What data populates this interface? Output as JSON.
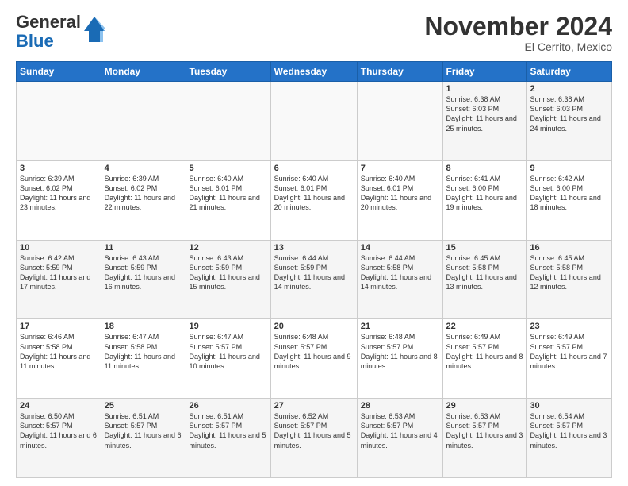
{
  "logo": {
    "general": "General",
    "blue": "Blue"
  },
  "title": "November 2024",
  "location": "El Cerrito, Mexico",
  "days_header": [
    "Sunday",
    "Monday",
    "Tuesday",
    "Wednesday",
    "Thursday",
    "Friday",
    "Saturday"
  ],
  "weeks": [
    [
      {
        "day": "",
        "content": ""
      },
      {
        "day": "",
        "content": ""
      },
      {
        "day": "",
        "content": ""
      },
      {
        "day": "",
        "content": ""
      },
      {
        "day": "",
        "content": ""
      },
      {
        "day": "1",
        "content": "Sunrise: 6:38 AM\nSunset: 6:03 PM\nDaylight: 11 hours and 25 minutes."
      },
      {
        "day": "2",
        "content": "Sunrise: 6:38 AM\nSunset: 6:03 PM\nDaylight: 11 hours and 24 minutes."
      }
    ],
    [
      {
        "day": "3",
        "content": "Sunrise: 6:39 AM\nSunset: 6:02 PM\nDaylight: 11 hours and 23 minutes."
      },
      {
        "day": "4",
        "content": "Sunrise: 6:39 AM\nSunset: 6:02 PM\nDaylight: 11 hours and 22 minutes."
      },
      {
        "day": "5",
        "content": "Sunrise: 6:40 AM\nSunset: 6:01 PM\nDaylight: 11 hours and 21 minutes."
      },
      {
        "day": "6",
        "content": "Sunrise: 6:40 AM\nSunset: 6:01 PM\nDaylight: 11 hours and 20 minutes."
      },
      {
        "day": "7",
        "content": "Sunrise: 6:40 AM\nSunset: 6:01 PM\nDaylight: 11 hours and 20 minutes."
      },
      {
        "day": "8",
        "content": "Sunrise: 6:41 AM\nSunset: 6:00 PM\nDaylight: 11 hours and 19 minutes."
      },
      {
        "day": "9",
        "content": "Sunrise: 6:42 AM\nSunset: 6:00 PM\nDaylight: 11 hours and 18 minutes."
      }
    ],
    [
      {
        "day": "10",
        "content": "Sunrise: 6:42 AM\nSunset: 5:59 PM\nDaylight: 11 hours and 17 minutes."
      },
      {
        "day": "11",
        "content": "Sunrise: 6:43 AM\nSunset: 5:59 PM\nDaylight: 11 hours and 16 minutes."
      },
      {
        "day": "12",
        "content": "Sunrise: 6:43 AM\nSunset: 5:59 PM\nDaylight: 11 hours and 15 minutes."
      },
      {
        "day": "13",
        "content": "Sunrise: 6:44 AM\nSunset: 5:59 PM\nDaylight: 11 hours and 14 minutes."
      },
      {
        "day": "14",
        "content": "Sunrise: 6:44 AM\nSunset: 5:58 PM\nDaylight: 11 hours and 14 minutes."
      },
      {
        "day": "15",
        "content": "Sunrise: 6:45 AM\nSunset: 5:58 PM\nDaylight: 11 hours and 13 minutes."
      },
      {
        "day": "16",
        "content": "Sunrise: 6:45 AM\nSunset: 5:58 PM\nDaylight: 11 hours and 12 minutes."
      }
    ],
    [
      {
        "day": "17",
        "content": "Sunrise: 6:46 AM\nSunset: 5:58 PM\nDaylight: 11 hours and 11 minutes."
      },
      {
        "day": "18",
        "content": "Sunrise: 6:47 AM\nSunset: 5:58 PM\nDaylight: 11 hours and 11 minutes."
      },
      {
        "day": "19",
        "content": "Sunrise: 6:47 AM\nSunset: 5:57 PM\nDaylight: 11 hours and 10 minutes."
      },
      {
        "day": "20",
        "content": "Sunrise: 6:48 AM\nSunset: 5:57 PM\nDaylight: 11 hours and 9 minutes."
      },
      {
        "day": "21",
        "content": "Sunrise: 6:48 AM\nSunset: 5:57 PM\nDaylight: 11 hours and 8 minutes."
      },
      {
        "day": "22",
        "content": "Sunrise: 6:49 AM\nSunset: 5:57 PM\nDaylight: 11 hours and 8 minutes."
      },
      {
        "day": "23",
        "content": "Sunrise: 6:49 AM\nSunset: 5:57 PM\nDaylight: 11 hours and 7 minutes."
      }
    ],
    [
      {
        "day": "24",
        "content": "Sunrise: 6:50 AM\nSunset: 5:57 PM\nDaylight: 11 hours and 6 minutes."
      },
      {
        "day": "25",
        "content": "Sunrise: 6:51 AM\nSunset: 5:57 PM\nDaylight: 11 hours and 6 minutes."
      },
      {
        "day": "26",
        "content": "Sunrise: 6:51 AM\nSunset: 5:57 PM\nDaylight: 11 hours and 5 minutes."
      },
      {
        "day": "27",
        "content": "Sunrise: 6:52 AM\nSunset: 5:57 PM\nDaylight: 11 hours and 5 minutes."
      },
      {
        "day": "28",
        "content": "Sunrise: 6:53 AM\nSunset: 5:57 PM\nDaylight: 11 hours and 4 minutes."
      },
      {
        "day": "29",
        "content": "Sunrise: 6:53 AM\nSunset: 5:57 PM\nDaylight: 11 hours and 3 minutes."
      },
      {
        "day": "30",
        "content": "Sunrise: 6:54 AM\nSunset: 5:57 PM\nDaylight: 11 hours and 3 minutes."
      }
    ]
  ]
}
